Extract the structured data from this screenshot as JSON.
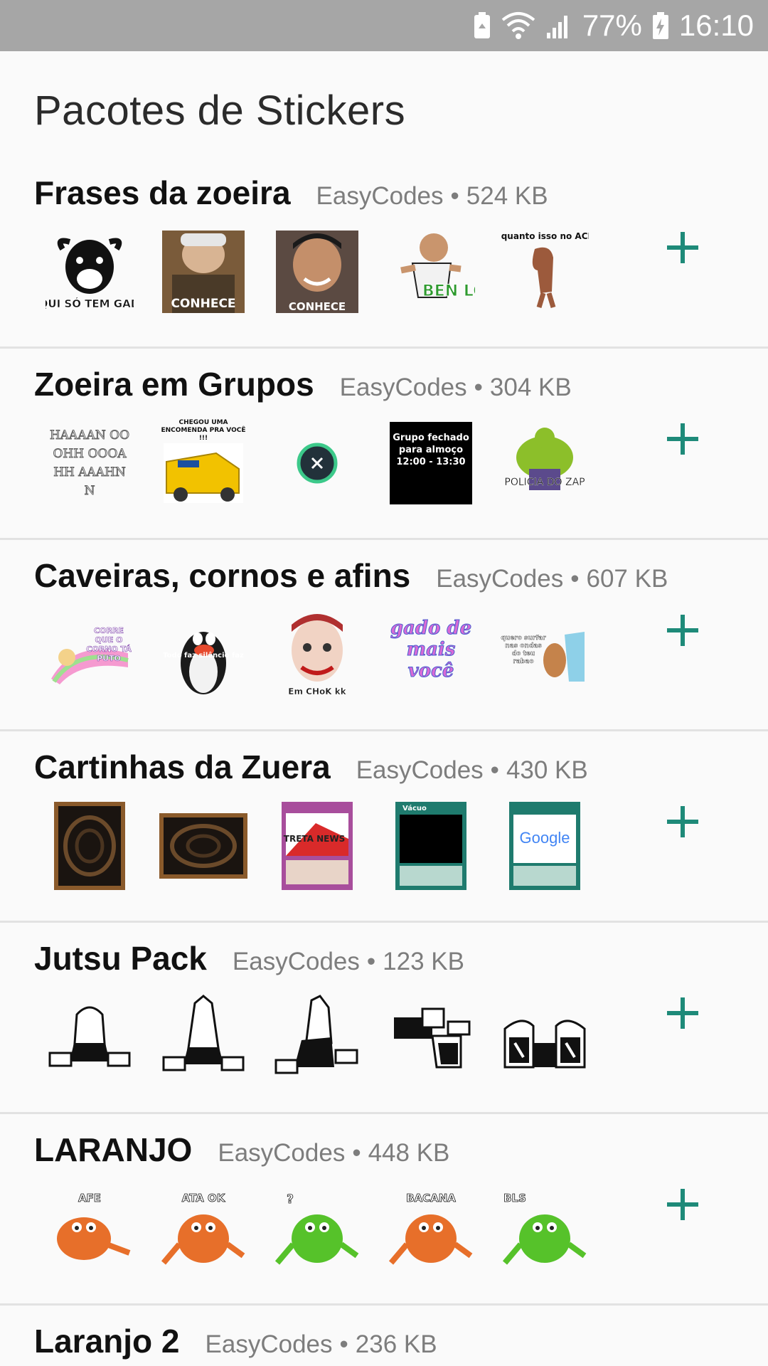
{
  "status_bar": {
    "battery_percent": "77%",
    "time": "16:10",
    "icons": [
      "battery-saver-icon",
      "wifi-icon",
      "signal-icon",
      "battery-charging-icon"
    ]
  },
  "header": {
    "title": "Pacotes de Stickers"
  },
  "accent_color": "#1e8a79",
  "packs": [
    {
      "name": "Frases da zoeira",
      "author": "EasyCodes",
      "size": "524 KB",
      "stickers": [
        "AQUI SÓ TEM GADO",
        "CONHECE",
        "CONHECE",
        "BEN LOCO",
        "enquanto isso no ACRE"
      ]
    },
    {
      "name": "Zoeira em Grupos",
      "author": "EasyCodes",
      "size": "304 KB",
      "stickers": [
        "HAAAAN OOOHH OOOAHH AAAHNN",
        "CHEGOU UMA ENCOMENDA PRA VOCÊ !!!",
        "",
        "Grupo fechado para almoço 12:00 - 13:30",
        "POLICIA DO ZAP"
      ]
    },
    {
      "name": "Caveiras, cornos e afins",
      "author": "EasyCodes",
      "size": "607 KB",
      "stickers": [
        "CORRE QUE O CORNO TÁ PUTO",
        "Todo faz silêncio faz",
        "Em CHoK kk",
        "gado de mais você",
        "quero surfar nas ondas do teu rabao"
      ]
    },
    {
      "name": "Cartinhas da Zuera",
      "author": "EasyCodes",
      "size": "430 KB",
      "stickers": [
        "",
        "",
        "TRETA NEWS",
        "Vácuo",
        "Google"
      ]
    },
    {
      "name": "Jutsu Pack",
      "author": "EasyCodes",
      "size": "123 KB",
      "stickers": [
        "",
        "",
        "",
        "",
        ""
      ]
    },
    {
      "name": "LARANJO",
      "author": "EasyCodes",
      "size": "448 KB",
      "stickers": [
        "AFE",
        "ATA OK",
        "?",
        "BACANA",
        "BLS"
      ]
    },
    {
      "name": "Laranjo 2",
      "author": "EasyCodes",
      "size": "236 KB",
      "stickers": []
    }
  ]
}
